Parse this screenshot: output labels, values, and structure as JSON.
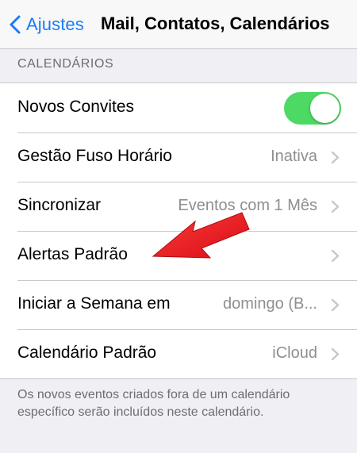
{
  "navbar": {
    "back_label": "Ajustes",
    "title": "Mail, Contatos, Calendários",
    "accent": "#1a7cf5"
  },
  "section": {
    "header": "CALENDÁRIOS",
    "rows": [
      {
        "label": "Novos Convites",
        "control": "toggle",
        "toggle_on": true
      },
      {
        "label": "Gestão Fuso Horário",
        "value": "Inativa"
      },
      {
        "label": "Sincronizar",
        "value": "Eventos com 1 Mês"
      },
      {
        "label": "Alertas Padrão",
        "value": ""
      },
      {
        "label": "Iniciar a Semana em",
        "value": "domingo (B..."
      },
      {
        "label": "Calendário Padrão",
        "value": "iCloud"
      }
    ],
    "footer": "Os novos eventos criados fora de um calendário específico serão incluídos neste calendário."
  },
  "colors": {
    "toggle_on": "#4cd964",
    "annotation_arrow": "#e8141b"
  },
  "icons": {
    "back": "chevron-left-icon",
    "disclosure": "chevron-right-icon",
    "annotation": "red-arrow-icon"
  }
}
